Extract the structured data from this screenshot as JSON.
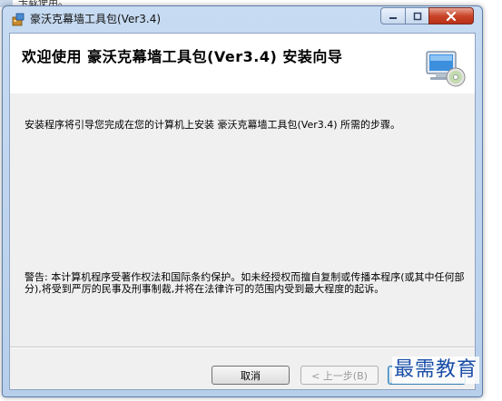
{
  "top_strip": {
    "text": "卡载使用。"
  },
  "window": {
    "title": "豪沃克幕墙工具包(Ver3.4)",
    "controls": {
      "minimize": "minimize",
      "maximize": "maximize",
      "close": "close"
    }
  },
  "header": {
    "title": "欢迎使用 豪沃克幕墙工具包(Ver3.4) 安装向导"
  },
  "body": {
    "intro": "安装程序将引导您完成在您的计算机上安装 豪沃克幕墙工具包(Ver3.4) 所需的步骤。",
    "warning": "警告: 本计算机程序受著作权法和国际条约保护。如未经授权而擅自复制或传播本程序(或其中任何部分),将受到严厉的民事及刑事制裁,并将在法律许可的范围内受到最大程度的起诉。"
  },
  "buttons": {
    "cancel": "取消",
    "back": "< 上一步(B)",
    "next": ""
  },
  "watermark": {
    "text": "最需教育"
  },
  "icons": {
    "app": "installer-app-icon",
    "header": "computer-disc-icon"
  },
  "colors": {
    "close": "#c9452a",
    "watermark": "#1a4da8",
    "titlebar": "#c7dbf2"
  }
}
